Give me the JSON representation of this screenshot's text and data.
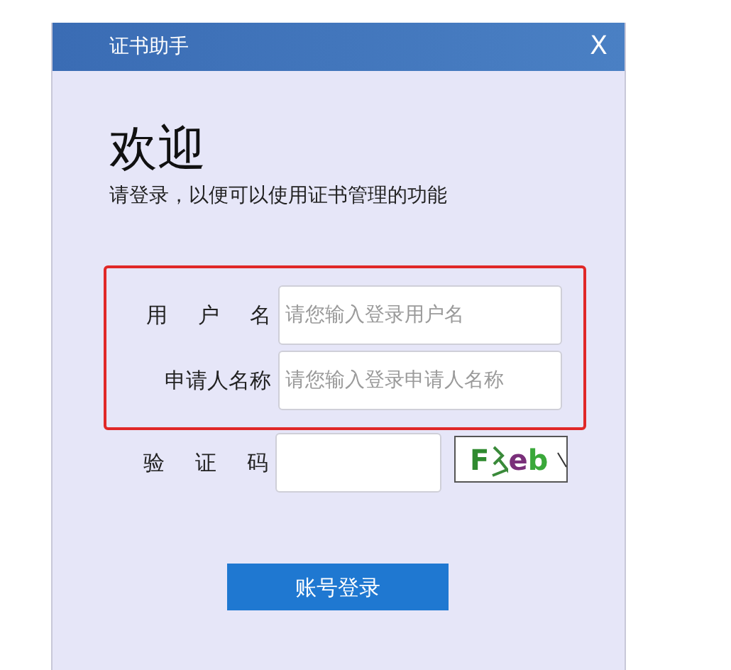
{
  "window": {
    "title": "证书助手",
    "close": "X"
  },
  "heading": "欢迎",
  "subtitle": "请登录，以便可以使用证书管理的功能",
  "fields": [
    {
      "label": "用 户 名",
      "placeholder": "请您输入登录用户名",
      "highlighted": true
    },
    {
      "label": "申请人名称",
      "placeholder": "请您输入登录申请人名称",
      "highlighted": true
    }
  ],
  "captcha": {
    "label": "验 证 码",
    "characters": [
      {
        "text": "F",
        "color": "#2f8a2f"
      },
      {
        "text": "e",
        "color": "#7a2f7a"
      },
      {
        "text": "b",
        "color": "#3aa83a"
      }
    ]
  },
  "login_button": "账号登录"
}
